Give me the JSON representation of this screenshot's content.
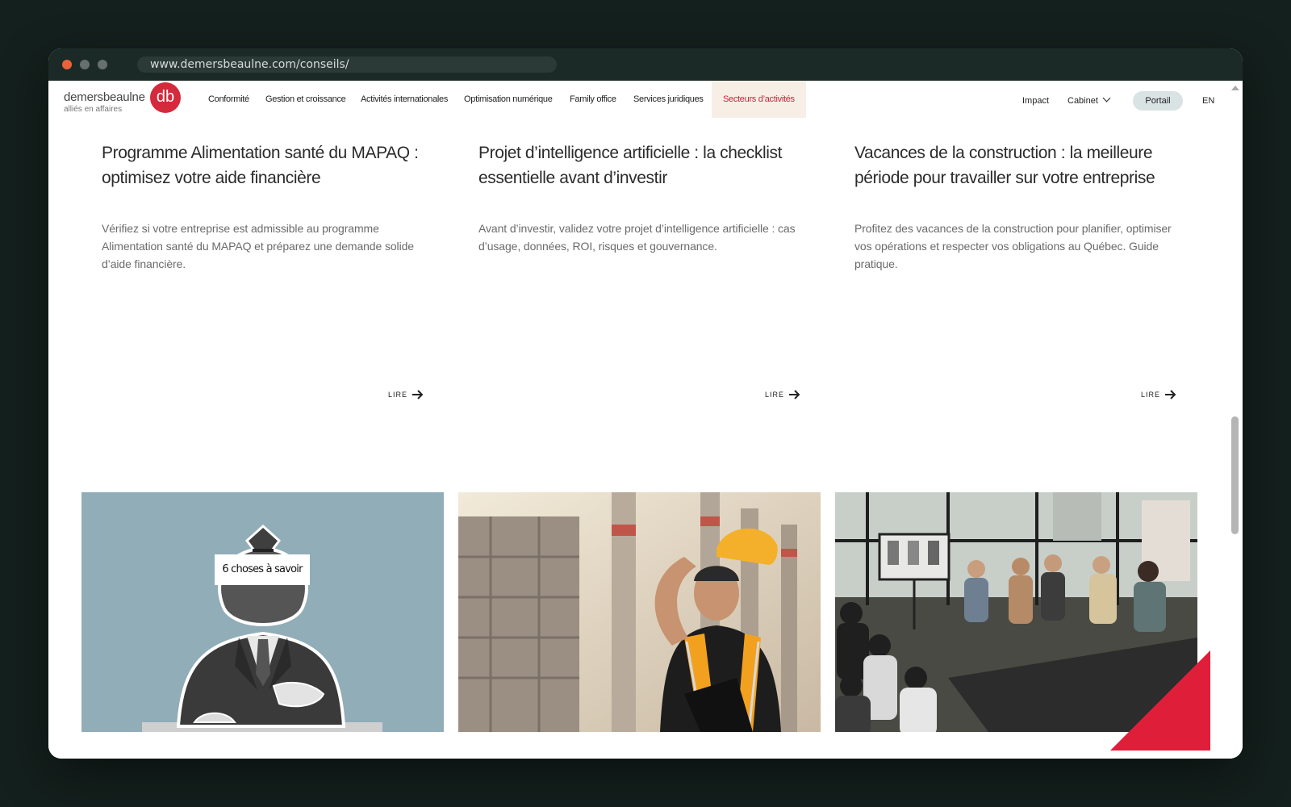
{
  "browser": {
    "url": "www.demersbeaulne.com/conseils/"
  },
  "header": {
    "logo_name": "demersbeaulne",
    "logo_tagline": "alliés en affaires",
    "logo_mark": "db",
    "nav": [
      {
        "label": "Conformité"
      },
      {
        "label": "Gestion et croissance"
      },
      {
        "label": "Activités internationales"
      },
      {
        "label": "Optimisation numérique"
      },
      {
        "label": "Family office"
      },
      {
        "label": "Services juridiques"
      },
      {
        "label": "Secteurs d’activités",
        "active": true
      }
    ],
    "right_nav": {
      "impact": "Impact",
      "cabinet": "Cabinet",
      "portal": "Portail",
      "lang": "EN"
    }
  },
  "articles": [
    {
      "title": "Programme Alimentation santé du MAPAQ : optimisez votre aide financière",
      "description": "Vérifiez si votre entreprise est admissible au programme Alimentation santé du MAPAQ et préparez une demande solide d’aide financière.",
      "cta": "LIRE"
    },
    {
      "title": "Projet d’intelligence artificielle : la checklist essentielle avant d’investir",
      "description": "Avant d’investir, validez votre projet d’intelligence artificielle : cas d’usage, données, ROI, risques et gouvernance.",
      "cta": "LIRE"
    },
    {
      "title": "Vacances de la construction : la meilleure période pour travailler sur votre entreprise",
      "description": "Profitez des vacances de la construction pour planifier, optimiser vos opérations et respecter vos obligations au Québec. Guide pratique.",
      "cta": "LIRE"
    }
  ],
  "images": [
    {
      "caption": "6 choses à savoir",
      "subject": "money-bag-head-businessman"
    },
    {
      "subject": "construction-worker-with-hard-hat"
    },
    {
      "subject": "panel-discussion-audience"
    }
  ],
  "colors": {
    "brand_red": "#d42a3c",
    "active_nav_bg": "#f7efe6",
    "active_nav_text": "#cf1f3a",
    "portal_bg": "#d9e3e3",
    "image1_bg": "#91adb8"
  }
}
